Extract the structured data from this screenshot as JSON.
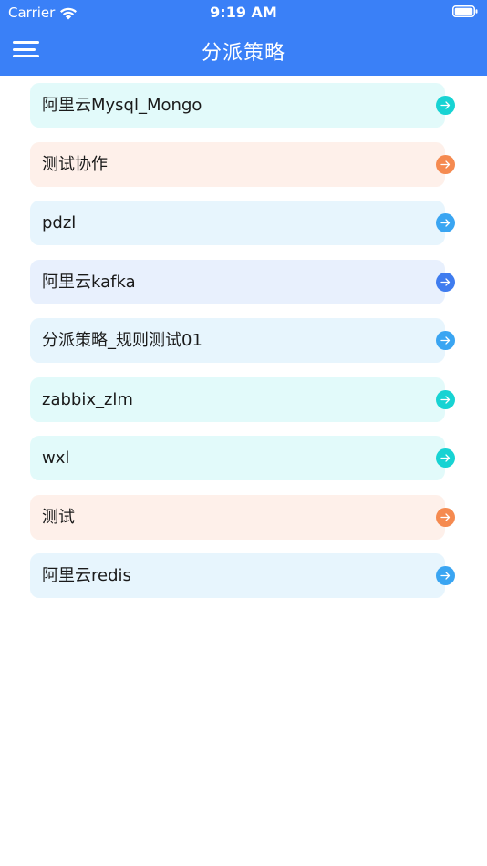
{
  "status_bar": {
    "carrier": "Carrier",
    "time": "9:19 AM"
  },
  "nav": {
    "title": "分派策略"
  },
  "icons": {
    "menu": "hamburger-menu-icon",
    "wifi": "wifi-icon",
    "battery": "battery-icon",
    "arrow": "arrow-right-circle-icon"
  },
  "colors": {
    "header": "#3a80f7",
    "teal": "#17d3d3",
    "orange": "#f58a50",
    "blue": "#3aa5f2",
    "indigo": "#3f7cef"
  },
  "strategies": [
    {
      "label": "阿里云Mysql_Mongo",
      "bg": "#e2fafa",
      "accent": "#17d3d3"
    },
    {
      "label": "测试协作",
      "bg": "#fef0ea",
      "accent": "#f58a50"
    },
    {
      "label": "pdzl",
      "bg": "#e7f5fd",
      "accent": "#3aa5f2"
    },
    {
      "label": "阿里云kafka",
      "bg": "#e8f0fd",
      "accent": "#3f7cef"
    },
    {
      "label": "分派策略_规则测试01",
      "bg": "#e7f5fd",
      "accent": "#3aa5f2"
    },
    {
      "label": "zabbix_zlm",
      "bg": "#e2fafa",
      "accent": "#17d3d3"
    },
    {
      "label": "wxl",
      "bg": "#e2fafa",
      "accent": "#17d3d3"
    },
    {
      "label": "测试",
      "bg": "#fef0ea",
      "accent": "#f58a50"
    },
    {
      "label": "阿里云redis",
      "bg": "#e7f5fd",
      "accent": "#3aa5f2"
    }
  ]
}
